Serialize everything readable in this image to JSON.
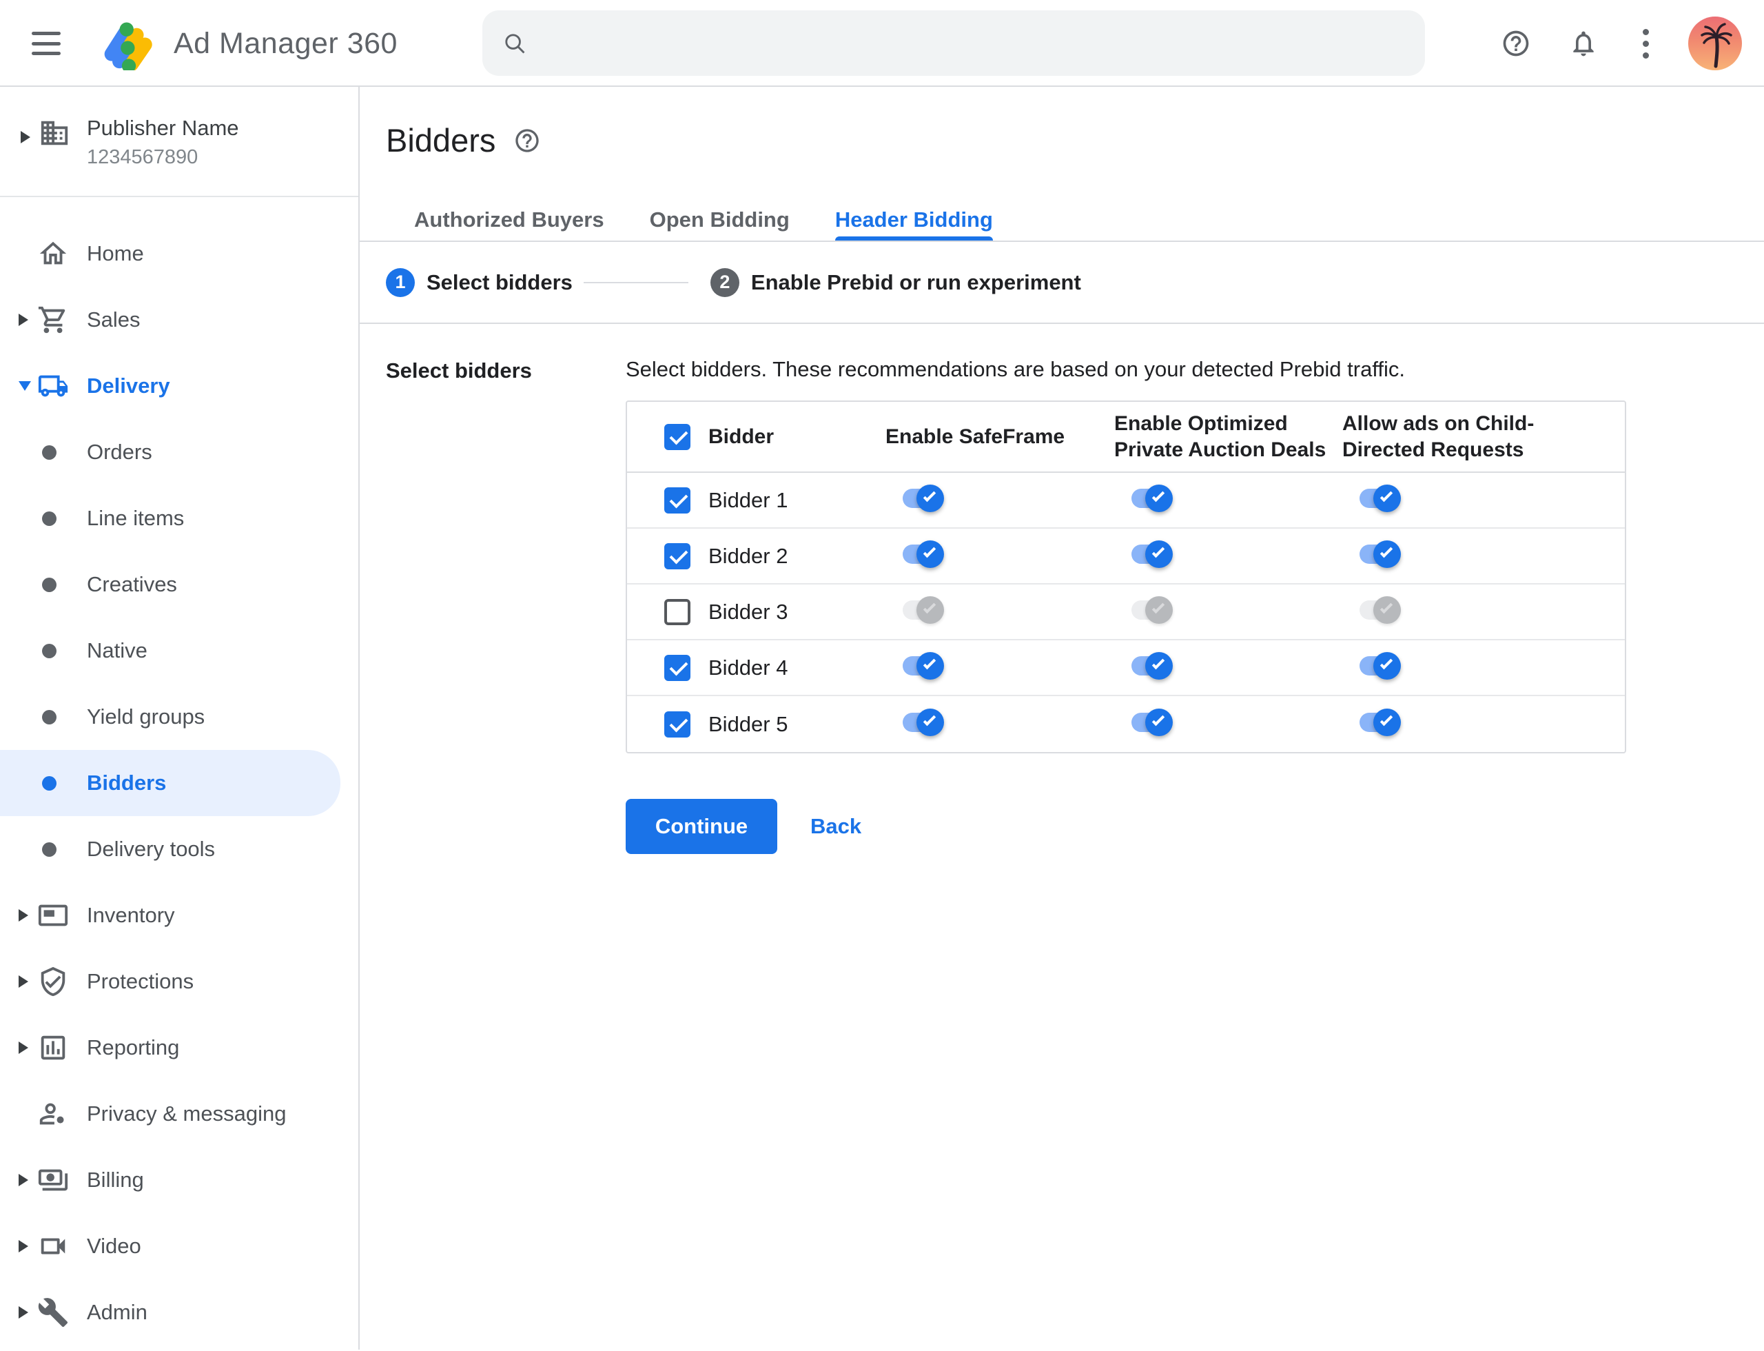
{
  "topbar": {
    "app_name": "Ad Manager 360",
    "search_value": "",
    "search_placeholder": ""
  },
  "icons": {
    "menu": "hamburger",
    "search": "magnifier",
    "help": "question-mark-circle",
    "notifications": "bell",
    "overflow": "three-dot-vertical",
    "avatar": "palm-tree-sunset-photo"
  },
  "sidebar": {
    "publisher_name": "Publisher Name",
    "publisher_id": "1234567890",
    "items": [
      {
        "label": "Home"
      },
      {
        "label": "Sales"
      },
      {
        "label": "Delivery",
        "expanded": true,
        "active": true
      },
      {
        "label": "Orders"
      },
      {
        "label": "Line items"
      },
      {
        "label": "Creatives"
      },
      {
        "label": "Native"
      },
      {
        "label": "Yield groups"
      },
      {
        "label": "Bidders",
        "selected": true
      },
      {
        "label": "Delivery tools"
      },
      {
        "label": "Inventory"
      },
      {
        "label": "Protections"
      },
      {
        "label": "Reporting"
      },
      {
        "label": "Privacy & messaging"
      },
      {
        "label": "Billing"
      },
      {
        "label": "Video"
      },
      {
        "label": "Admin"
      }
    ]
  },
  "main": {
    "title": "Bidders",
    "tabs": [
      {
        "label": "Authorized Buyers",
        "active": false
      },
      {
        "label": "Open Bidding",
        "active": false
      },
      {
        "label": "Header Bidding",
        "active": true
      }
    ],
    "steps": [
      {
        "number": "1",
        "label": "Select bidders",
        "state": "active"
      },
      {
        "number": "2",
        "label": "Enable Prebid or run experiment",
        "state": "upcoming"
      }
    ],
    "section_label": "Select bidders",
    "description": "Select bidders. These recommendations are based on your detected Prebid traffic.",
    "table": {
      "header_checkbox_checked": true,
      "columns": [
        "Bidder",
        "Enable SafeFrame",
        "Enable Optimized Private Auction Deals",
        "Allow ads on Child-Directed Requests"
      ],
      "rows": [
        {
          "name": "Bidder 1",
          "selected": true,
          "safeframe": true,
          "optimized_private_auction": true,
          "child_directed": true
        },
        {
          "name": "Bidder 2",
          "selected": true,
          "safeframe": true,
          "optimized_private_auction": true,
          "child_directed": true
        },
        {
          "name": "Bidder 3",
          "selected": false,
          "safeframe": true,
          "optimized_private_auction": true,
          "child_directed": true
        },
        {
          "name": "Bidder 4",
          "selected": true,
          "safeframe": true,
          "optimized_private_auction": true,
          "child_directed": true
        },
        {
          "name": "Bidder 5",
          "selected": true,
          "safeframe": true,
          "optimized_private_auction": true,
          "child_directed": true
        }
      ]
    },
    "continue_label": "Continue",
    "back_label": "Back"
  },
  "colors": {
    "accent": "#1A73E8",
    "toggle_on_track": "#8AB4F8",
    "selected_nav_bg": "#E8F0FE",
    "divider": "#DADCE0",
    "gray_text": "#5F6368",
    "logo_blue": "#4285F4",
    "logo_yellow": "#FBBC04",
    "logo_green": "#34A853"
  }
}
